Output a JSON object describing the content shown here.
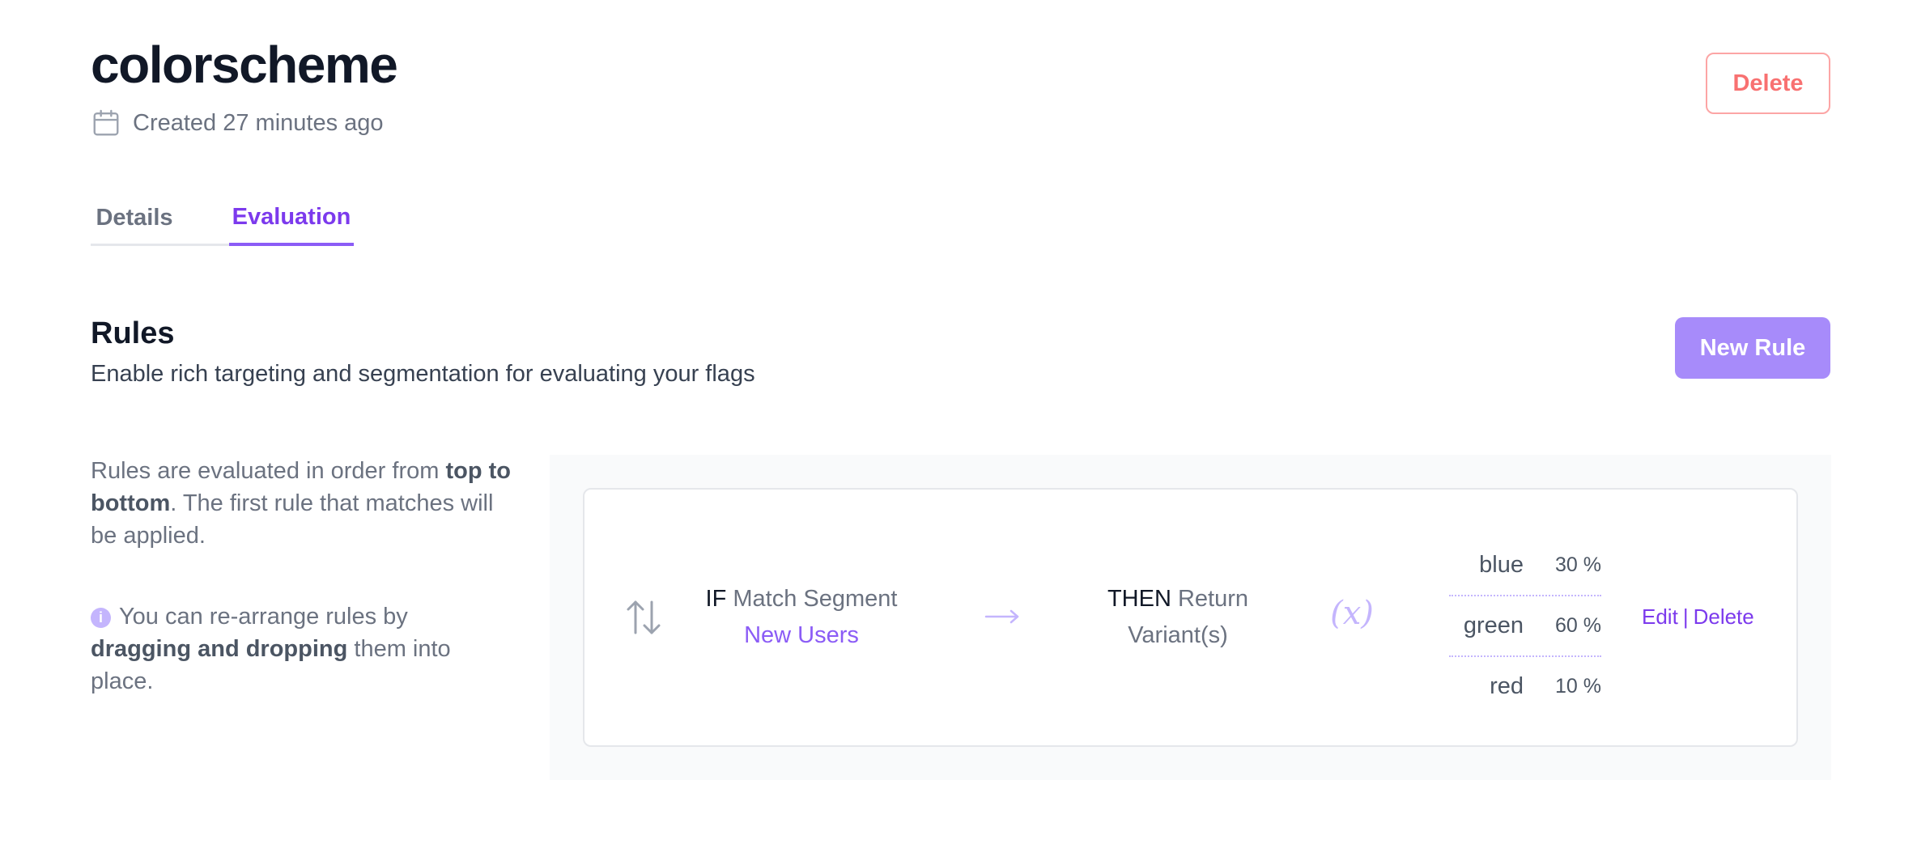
{
  "header": {
    "title": "colorscheme",
    "created": "Created 27 minutes ago",
    "delete_label": "Delete"
  },
  "tabs": [
    {
      "label": "Details",
      "active": false
    },
    {
      "label": "Evaluation",
      "active": true
    }
  ],
  "rules": {
    "heading": "Rules",
    "subtitle": "Enable rich targeting and segmentation for evaluating your flags",
    "new_rule_label": "New Rule",
    "help": {
      "line1_pre": "Rules are evaluated in order from ",
      "line1_bold": "top to bottom",
      "line1_post": ". The first rule that matches will be applied.",
      "line2_pre": "You can re-arrange rules by ",
      "line2_bold": "dragging and dropping",
      "line2_post": " them into place."
    },
    "items": [
      {
        "if_kw": "IF",
        "match_text": "Match Segment",
        "segment": "New Users",
        "then_kw": "THEN",
        "then_text": "Return Variant(s)",
        "fx_symbol": "(x)",
        "distributions": [
          {
            "variant": "blue",
            "percent": "30 %"
          },
          {
            "variant": "green",
            "percent": "60 %"
          },
          {
            "variant": "red",
            "percent": "10 %"
          }
        ],
        "edit_label": "Edit",
        "separator": "|",
        "delete_label": "Delete"
      }
    ]
  },
  "colors": {
    "accent": "#7c3aed",
    "accent_light": "#a78bfa",
    "danger": "#f87171",
    "muted": "#6b7280"
  },
  "icons": {
    "created": "calendar-icon",
    "drag": "drag-handle-icon",
    "arrow": "arrow-right-icon",
    "info": "info-icon",
    "variable": "variable-fx-icon"
  }
}
